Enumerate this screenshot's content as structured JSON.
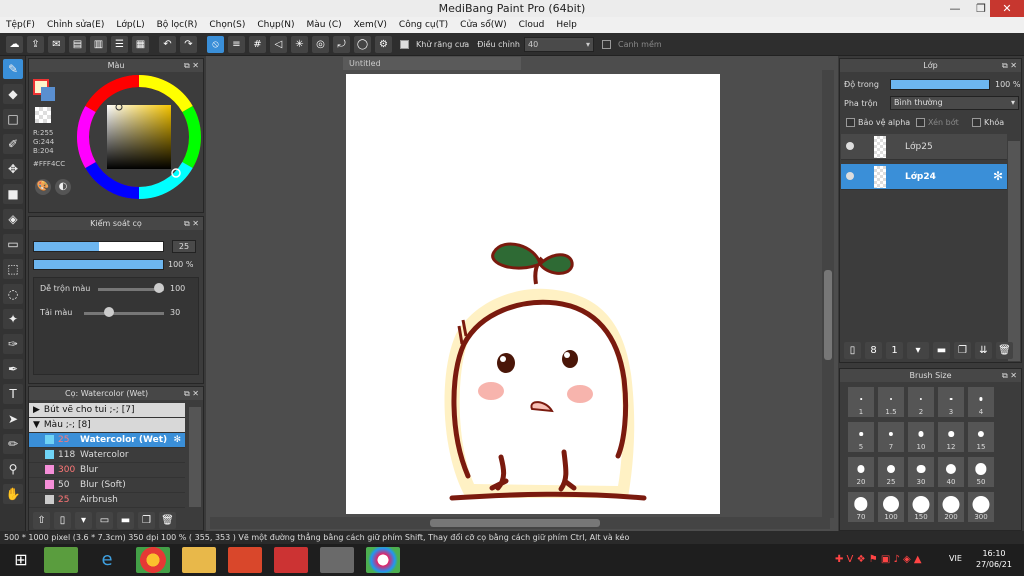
{
  "window": {
    "title": "MediBang Paint Pro (64bit)",
    "min": "—",
    "max": "❐",
    "close": "✕"
  },
  "menu": [
    "Tệp(F)",
    "Chỉnh sửa(E)",
    "Lớp(L)",
    "Bộ lọc(R)",
    "Chọn(S)",
    "Chụp(N)",
    "Màu (C)",
    "Xem(V)",
    "Công cụ(T)",
    "Cửa sổ(W)",
    "Cloud",
    "Help"
  ],
  "toolbar": {
    "antialias": "Khử răng cưa",
    "correction_label": "Điều chỉnh",
    "correction_value": "40",
    "edge_label": "Canh mềm"
  },
  "color_panel": {
    "title": "Màu",
    "r": "R:255",
    "g": "G:244",
    "b": "B:204",
    "hex": "#FFF4CC",
    "accent": "#FFF4CC"
  },
  "brush_control": {
    "title": "Kiểm soát cọ",
    "size": "25",
    "opacity": "100 %",
    "blend_label": "Dễ trộn màu",
    "blend_value": "100",
    "amount_label": "Tải màu",
    "amount_value": "30",
    "size_fraction": 0.5,
    "opacity_fraction": 1.0
  },
  "brush_list": {
    "title": "Cọ: Watercolor (Wet)",
    "groups": [
      {
        "label": "Bút vẽ cho tui ;-; [7]",
        "arrow": "▶"
      },
      {
        "label": "Màu ;-; [8]",
        "arrow": "▼"
      }
    ],
    "items": [
      {
        "size": "25",
        "name": "Watercolor (Wet)",
        "color": "#6fd3f5",
        "selected": true
      },
      {
        "size": "118",
        "name": "Watercolor",
        "color": "#6fd3f5",
        "selected": false
      },
      {
        "size": "300",
        "name": "Blur",
        "color": "#f58fd8",
        "selected": false
      },
      {
        "size": "50",
        "name": "Blur (Soft)",
        "color": "#f58fd8",
        "selected": false
      },
      {
        "size": "25",
        "name": "Airbrush",
        "color": "#cccccc",
        "selected": false
      }
    ]
  },
  "canvas": {
    "tab": "Untitled"
  },
  "layer_panel": {
    "title": "Lớp",
    "opacity_label": "Độ trong",
    "opacity_value": "100 %",
    "blend_label": "Pha trộn",
    "blend_value": "Bình thường",
    "protect_alpha": "Bảo vệ alpha",
    "clipping": "Xén bớt",
    "lock": "Khóa",
    "layers": [
      {
        "name": "Lớp25",
        "selected": false
      },
      {
        "name": "Lớp24",
        "selected": true
      }
    ]
  },
  "brush_size": {
    "title": "Brush Size",
    "sizes": [
      "1",
      "1.5",
      "2",
      "3",
      "4",
      "5",
      "7",
      "10",
      "12",
      "15",
      "20",
      "25",
      "30",
      "40",
      "50",
      "70",
      "100",
      "150",
      "200",
      "300"
    ]
  },
  "status": "500 * 1000 pixel   (3.6 * 7.3cm)   350 dpi   100 %   ( 355, 353 )   Vẽ một đường thẳng bằng cách giữ phím Shift, Thay đổi cỡ cọ bằng cách giữ phím Ctrl, Alt và kéo",
  "taskbar": {
    "lang": "VIE",
    "time": "16:10",
    "date": "27/06/21"
  }
}
